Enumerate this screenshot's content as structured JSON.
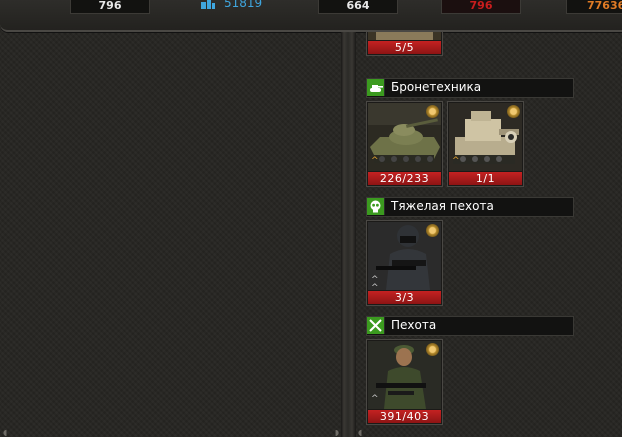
{
  "resources": {
    "r1": "796",
    "population": "51819",
    "r2": "664",
    "r3": "796",
    "r4": "77636"
  },
  "top_card": {
    "count": "5/5"
  },
  "categories": [
    {
      "label": "Бронетехника",
      "icon": "tank-icon",
      "units": [
        {
          "count": "226/233",
          "rank": "gold"
        },
        {
          "count": "1/1",
          "rank": "gold"
        }
      ]
    },
    {
      "label": "Тяжелая пехота",
      "icon": "skull-icon",
      "units": [
        {
          "count": "3/3",
          "rank": "grey"
        }
      ]
    },
    {
      "label": "Пехота",
      "icon": "crossed-swords-icon",
      "units": [
        {
          "count": "391/403",
          "rank": "grey"
        }
      ]
    }
  ],
  "colors": {
    "count_bar": "#c42222",
    "category_icon": "#3b9a1f",
    "population": "#3fa6de"
  }
}
